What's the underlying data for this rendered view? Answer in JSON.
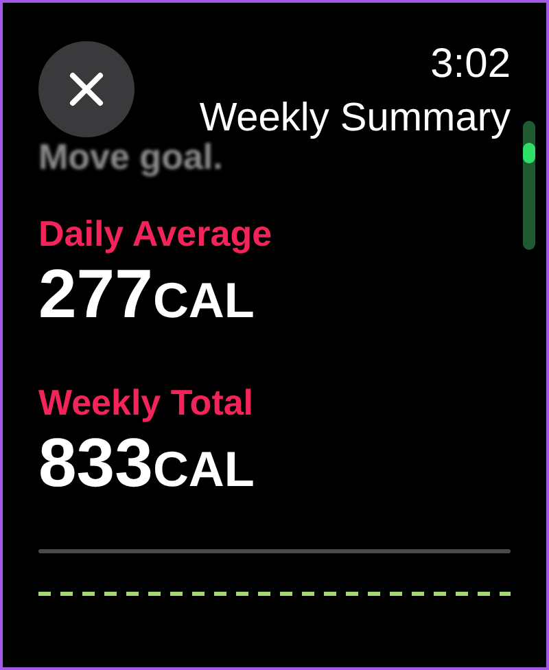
{
  "time": "3:02",
  "title": "Weekly Summary",
  "faded_text": "Move goal.",
  "stats": [
    {
      "label": "Daily Average",
      "value": "277",
      "unit": "CAL"
    },
    {
      "label": "Weekly Total",
      "value": "833",
      "unit": "CAL"
    }
  ]
}
